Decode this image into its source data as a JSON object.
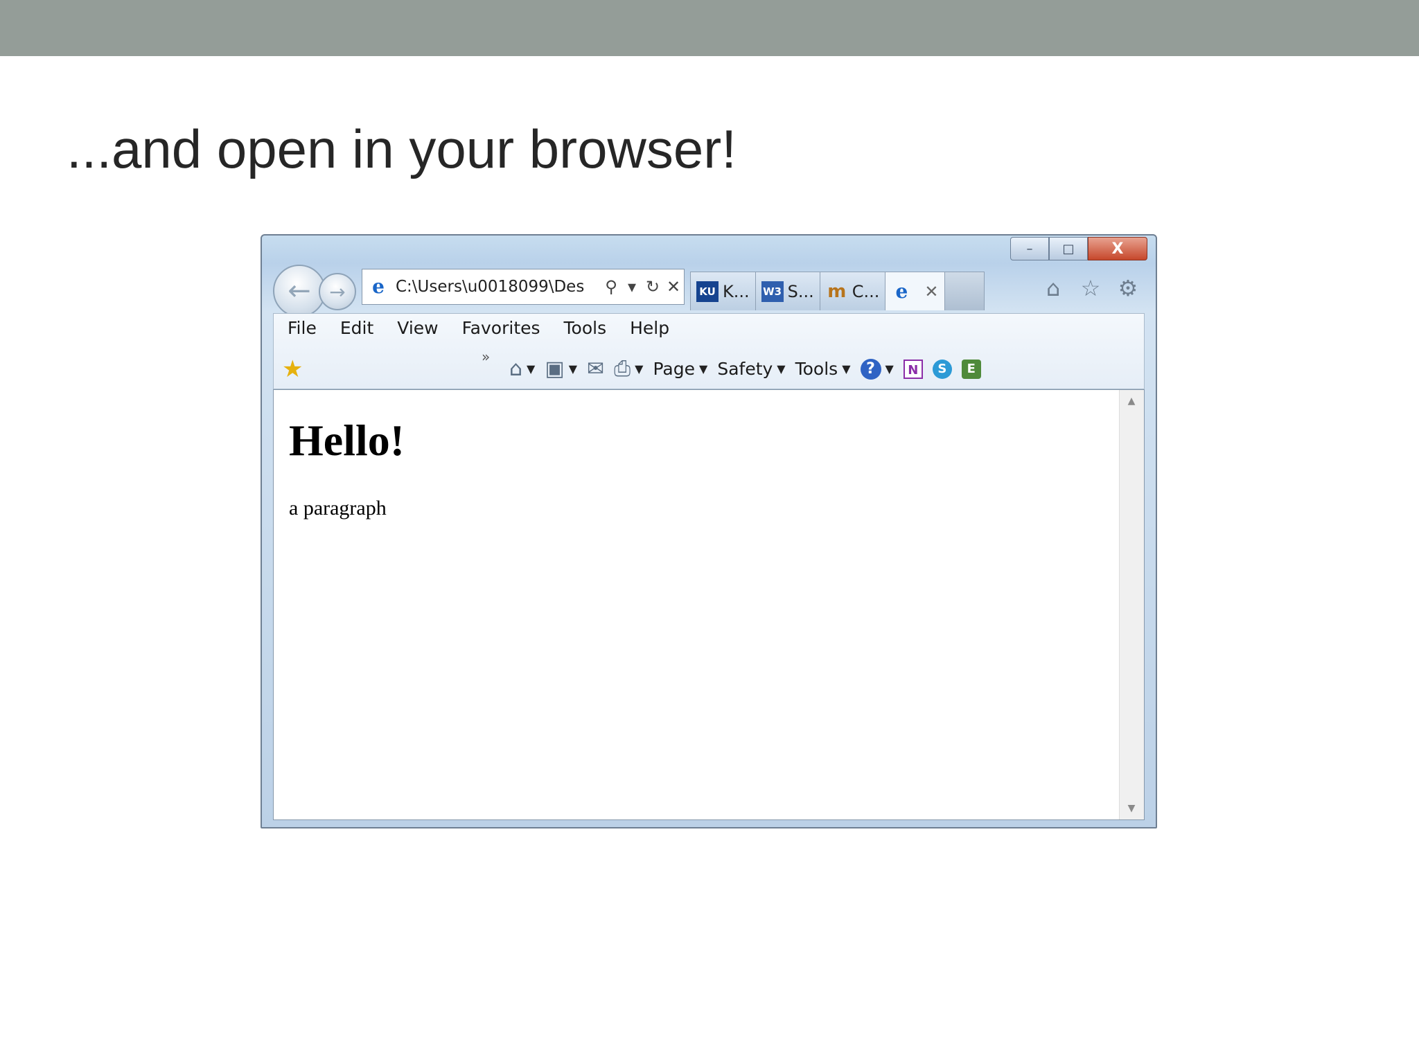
{
  "slide": {
    "title": "...and open in your browser!"
  },
  "browser": {
    "window_controls": {
      "minimize": "–",
      "maximize": "□",
      "close": "X"
    },
    "address": {
      "value": "C:\\Users\\u0018099\\Des",
      "search_icon": "⚲",
      "dropdown_icon": "▾",
      "refresh_icon": "↻",
      "stop_icon": "✕"
    },
    "tabs": [
      {
        "favicon": "KU",
        "label": "K..."
      },
      {
        "favicon": "W3",
        "label": "S..."
      },
      {
        "favicon": "m",
        "label": "C..."
      },
      {
        "favicon": "e",
        "label": "",
        "close": "✕"
      }
    ],
    "toolbar_icons": {
      "home": "⌂",
      "favorites": "☆",
      "settings": "⚙"
    },
    "menubar": [
      "File",
      "Edit",
      "View",
      "Favorites",
      "Tools",
      "Help"
    ],
    "command_bar": {
      "chevron": "»",
      "page": "Page",
      "safety": "Safety",
      "tools": "Tools",
      "help_glyph": "?",
      "onenote_glyph": "N",
      "skype_glyph": "S",
      "evernote_glyph": "E"
    },
    "page": {
      "heading": "Hello!",
      "paragraph": "a paragraph"
    }
  }
}
